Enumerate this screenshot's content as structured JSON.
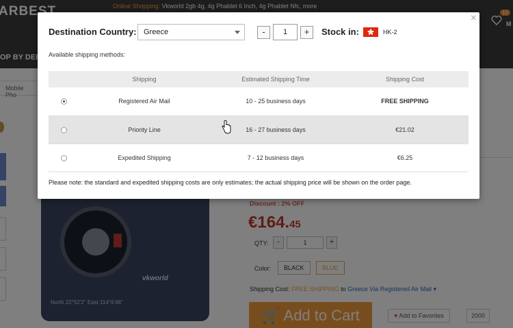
{
  "background": {
    "logo": "ARBEST",
    "promo_prefix": "Online Shopping:",
    "promo_text": "Vkworld 2gb 4g, 4g Phablet 6 Inch, 4g Phablet Nfc, more",
    "nav_label": "OP BY DEP",
    "cart_badge": "10",
    "cart_label": "M",
    "breadcrumb_tab": "Mobile Pho",
    "phone_brand": "vkworld",
    "phone_coords": "North 22°52'2\"  East 114°6'48\"",
    "discount": "Discount : 2% OFF",
    "price_main": "€164.",
    "price_cents": "45",
    "qty_label": "QTY:",
    "qty_value": "1",
    "color_label": "Color:",
    "color_options": [
      "BLACK",
      "BLUE"
    ],
    "shipping_cost_prefix": "Shipping Cost:",
    "shipping_cost_free": "FREE SHIPPING",
    "shipping_cost_to": "to",
    "shipping_cost_dest": "Greece Via Registered Air Mail",
    "add_to_cart": "Add to Cart",
    "add_to_favorites": "Add to Favorites",
    "favorites_count": "2000"
  },
  "modal": {
    "destination_label": "Destination Country:",
    "destination_value": "Greece",
    "quantity_value": "1",
    "minus_label": "-",
    "plus_label": "+",
    "stock_label": "Stock in:",
    "stock_value": "HK-2",
    "close_label": "×",
    "available_label": "Available shipping methods:",
    "table_headers": [
      "Shipping",
      "Estimated Shipping Time",
      "Shipping Cost"
    ],
    "rows": [
      {
        "method": "Registered Air Mail",
        "time": "10 - 25 business days",
        "cost": "FREE SHIPPING",
        "selected": true
      },
      {
        "method": "Priority Line",
        "time": "16 - 27 business days",
        "cost": "€21.02",
        "selected": false
      },
      {
        "method": "Expedited Shipping",
        "time": "7 - 12 business days",
        "cost": "€6.25",
        "selected": false
      }
    ],
    "note": "Please note: the standard and expedited shipping costs are only estimates; the actual shipping price will be shown on the order page."
  },
  "colors": {
    "accent_orange": "#f09a3a",
    "price_red": "#c0261f",
    "flag_red": "#de2910"
  }
}
